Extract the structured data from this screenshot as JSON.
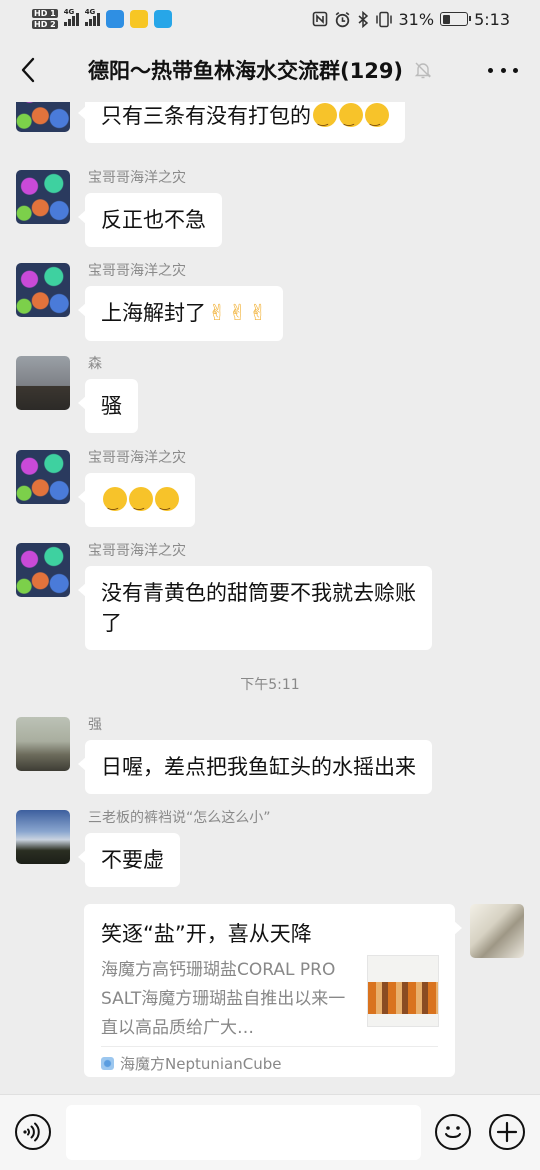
{
  "status_bar": {
    "sim1": "HD 1",
    "sim2": "HD 2",
    "network1": "4G",
    "network2": "4G",
    "battery_percent": "31%",
    "battery_level": 0.31,
    "time": "5:13",
    "icons": [
      "nfc-icon",
      "alarm-icon",
      "bluetooth-icon",
      "vibrate-icon",
      "battery-icon"
    ]
  },
  "header": {
    "title": "德阳～热带鱼林海水交流群(129)",
    "icons": [
      "back-icon",
      "mute-icon",
      "more-icon"
    ]
  },
  "messages": [
    {
      "sender": "",
      "text": "只有三条有没有打包的",
      "emoji": [
        "thinking",
        "thinking",
        "thinking"
      ]
    },
    {
      "sender": "宝哥哥海洋之灾",
      "text": "反正也不急",
      "emoji": []
    },
    {
      "sender": "宝哥哥海洋之灾",
      "text": "上海解封了",
      "emoji": [
        "victory",
        "victory",
        "victory"
      ]
    },
    {
      "sender": "森",
      "text": "骚",
      "emoji": []
    },
    {
      "sender": "宝哥哥海洋之灾",
      "text": "",
      "emoji": [
        "thinking",
        "thinking",
        "tears"
      ]
    },
    {
      "sender": "宝哥哥海洋之灾",
      "text_line1": "没有青黄色的甜筒要不我就去赊账",
      "text_line2": "了",
      "emoji": []
    },
    {
      "sender": "强",
      "text": "日喔，差点把我鱼缸头的水摇出来",
      "emoji": []
    },
    {
      "sender": "三老板的裤裆说“怎么这么小”",
      "text": "不要虚",
      "emoji": []
    }
  ],
  "timestamp": "下午5:11",
  "link_card": {
    "title": "笑逐“盐”开，喜从天降",
    "description": "海魔方高钙珊瑚盐CORAL PRO SALT海魔方珊瑚盐自推出以来一直以高品质给广大…",
    "source": "海魔方NeptunianCube"
  },
  "input_bar": {
    "text_value": "",
    "icons": [
      "voice-icon",
      "emoji-icon",
      "plus-icon"
    ]
  },
  "colors": {
    "background": "#ededed",
    "bubble": "#ffffff",
    "nickname": "#8a8a8a"
  }
}
